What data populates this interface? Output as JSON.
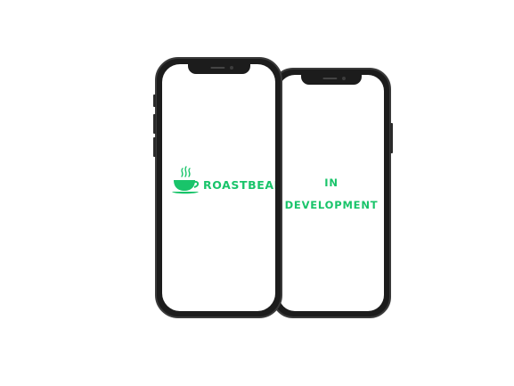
{
  "brand": {
    "name": "ROASTBEAN",
    "icon": "coffee-cup-icon",
    "color": "#19c46a"
  },
  "status": {
    "line1": "IN",
    "line2": "DEVELOPMENT"
  }
}
